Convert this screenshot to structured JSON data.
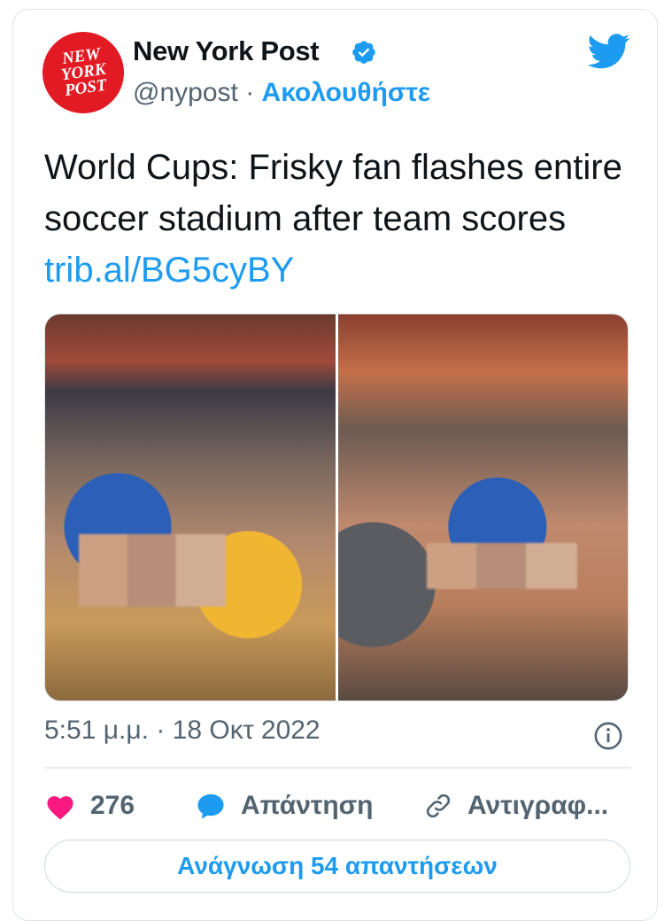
{
  "author": {
    "avatar_text": "NEW YORK POST",
    "name": "New York Post",
    "handle": "@nypost",
    "separator": "·",
    "follow_label": "Ακολουθήστε",
    "verified": true
  },
  "tweet": {
    "text": "World Cups: Frisky fan flashes entire soccer stadium after team scores",
    "link": "trib.al/BG5cyBY",
    "time": "5:51 μ.μ.",
    "date_separator": "·",
    "date": "18 Οκτ 2022"
  },
  "actions": {
    "likes_count": "276",
    "reply_label": "Απάντηση",
    "copy_label": "Αντιγραφ..."
  },
  "read_replies_label": "Ανάγνωση 54 απαντήσεων",
  "colors": {
    "accent": "#1d9bf0",
    "like": "#f91880",
    "brand": "#e21a23",
    "secondary_text": "#536471"
  },
  "icons": [
    "verified-badge-icon",
    "twitter-bird-icon",
    "info-icon",
    "heart-icon",
    "reply-bubble-icon",
    "link-icon"
  ]
}
